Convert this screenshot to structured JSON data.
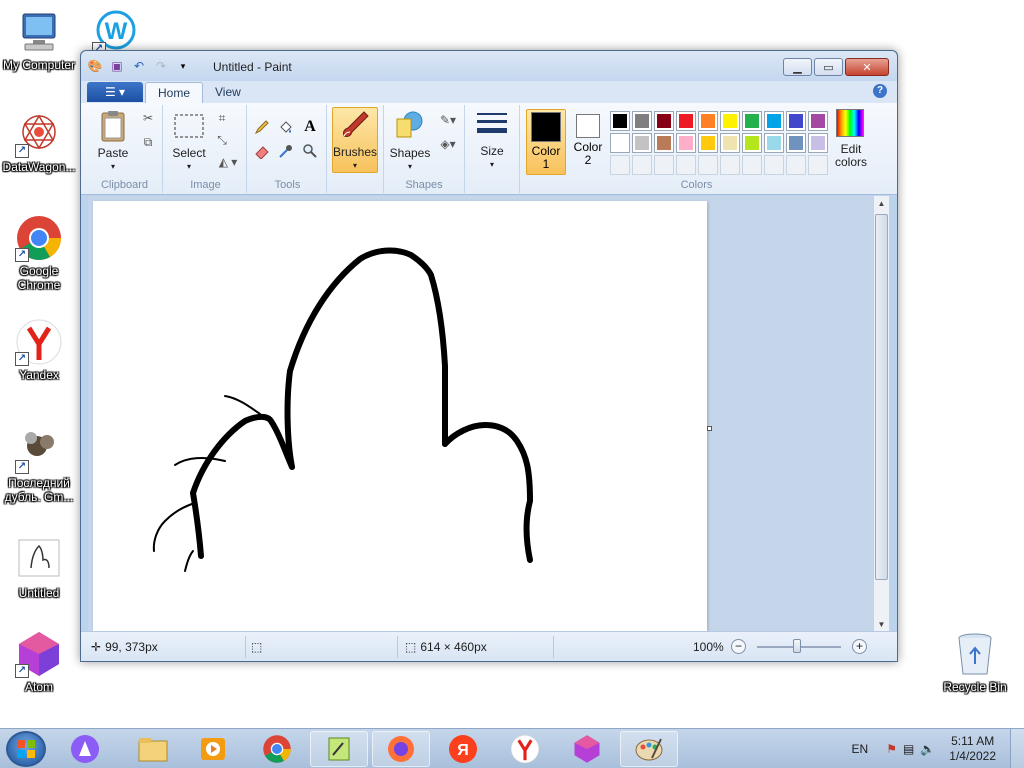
{
  "desktop": {
    "icons": [
      {
        "label": "My Computer"
      },
      {
        "label": ""
      },
      {
        "label": "DataWagon..."
      },
      {
        "label": "Google Chrome"
      },
      {
        "label": "Yandex"
      },
      {
        "label": "Последний дубль. Gm..."
      },
      {
        "label": "Untitled"
      },
      {
        "label": "Atom"
      },
      {
        "label": "Recycle Bin"
      }
    ]
  },
  "window": {
    "title": "Untitled - Paint",
    "tabs": {
      "home": "Home",
      "view": "View"
    },
    "help": "?",
    "ribbon": {
      "clipboard": {
        "paste": "Paste",
        "group": "Clipboard"
      },
      "image": {
        "select": "Select",
        "group": "Image"
      },
      "tools": {
        "group": "Tools"
      },
      "brushes": {
        "label": "Brushes"
      },
      "shapes": {
        "label": "Shapes",
        "group": "Shapes"
      },
      "size": {
        "label": "Size"
      },
      "colors": {
        "color1_label": "Color",
        "color1_num": "1",
        "color2_label": "Color",
        "color2_num": "2",
        "edit_label": "Edit",
        "edit_label2": "colors",
        "group": "Colors",
        "color1": "#000000",
        "color2": "#ffffff",
        "row1": [
          "#000000",
          "#7f7f7f",
          "#880015",
          "#ed1c24",
          "#ff7f27",
          "#fff200",
          "#22b14c",
          "#00a2e8",
          "#3f48cc",
          "#a349a4"
        ],
        "row2": [
          "#ffffff",
          "#c3c3c3",
          "#b97a57",
          "#ffaec9",
          "#ffc90e",
          "#efe4b0",
          "#b5e61d",
          "#99d9ea",
          "#7092be",
          "#c8bfe7"
        ]
      }
    },
    "status": {
      "cursor_pos": "99, 373px",
      "image_size": "614 × 460px",
      "zoom": "100%"
    }
  },
  "taskbar": {
    "lang": "EN",
    "time": "5:11 AM",
    "date": "1/4/2022"
  }
}
